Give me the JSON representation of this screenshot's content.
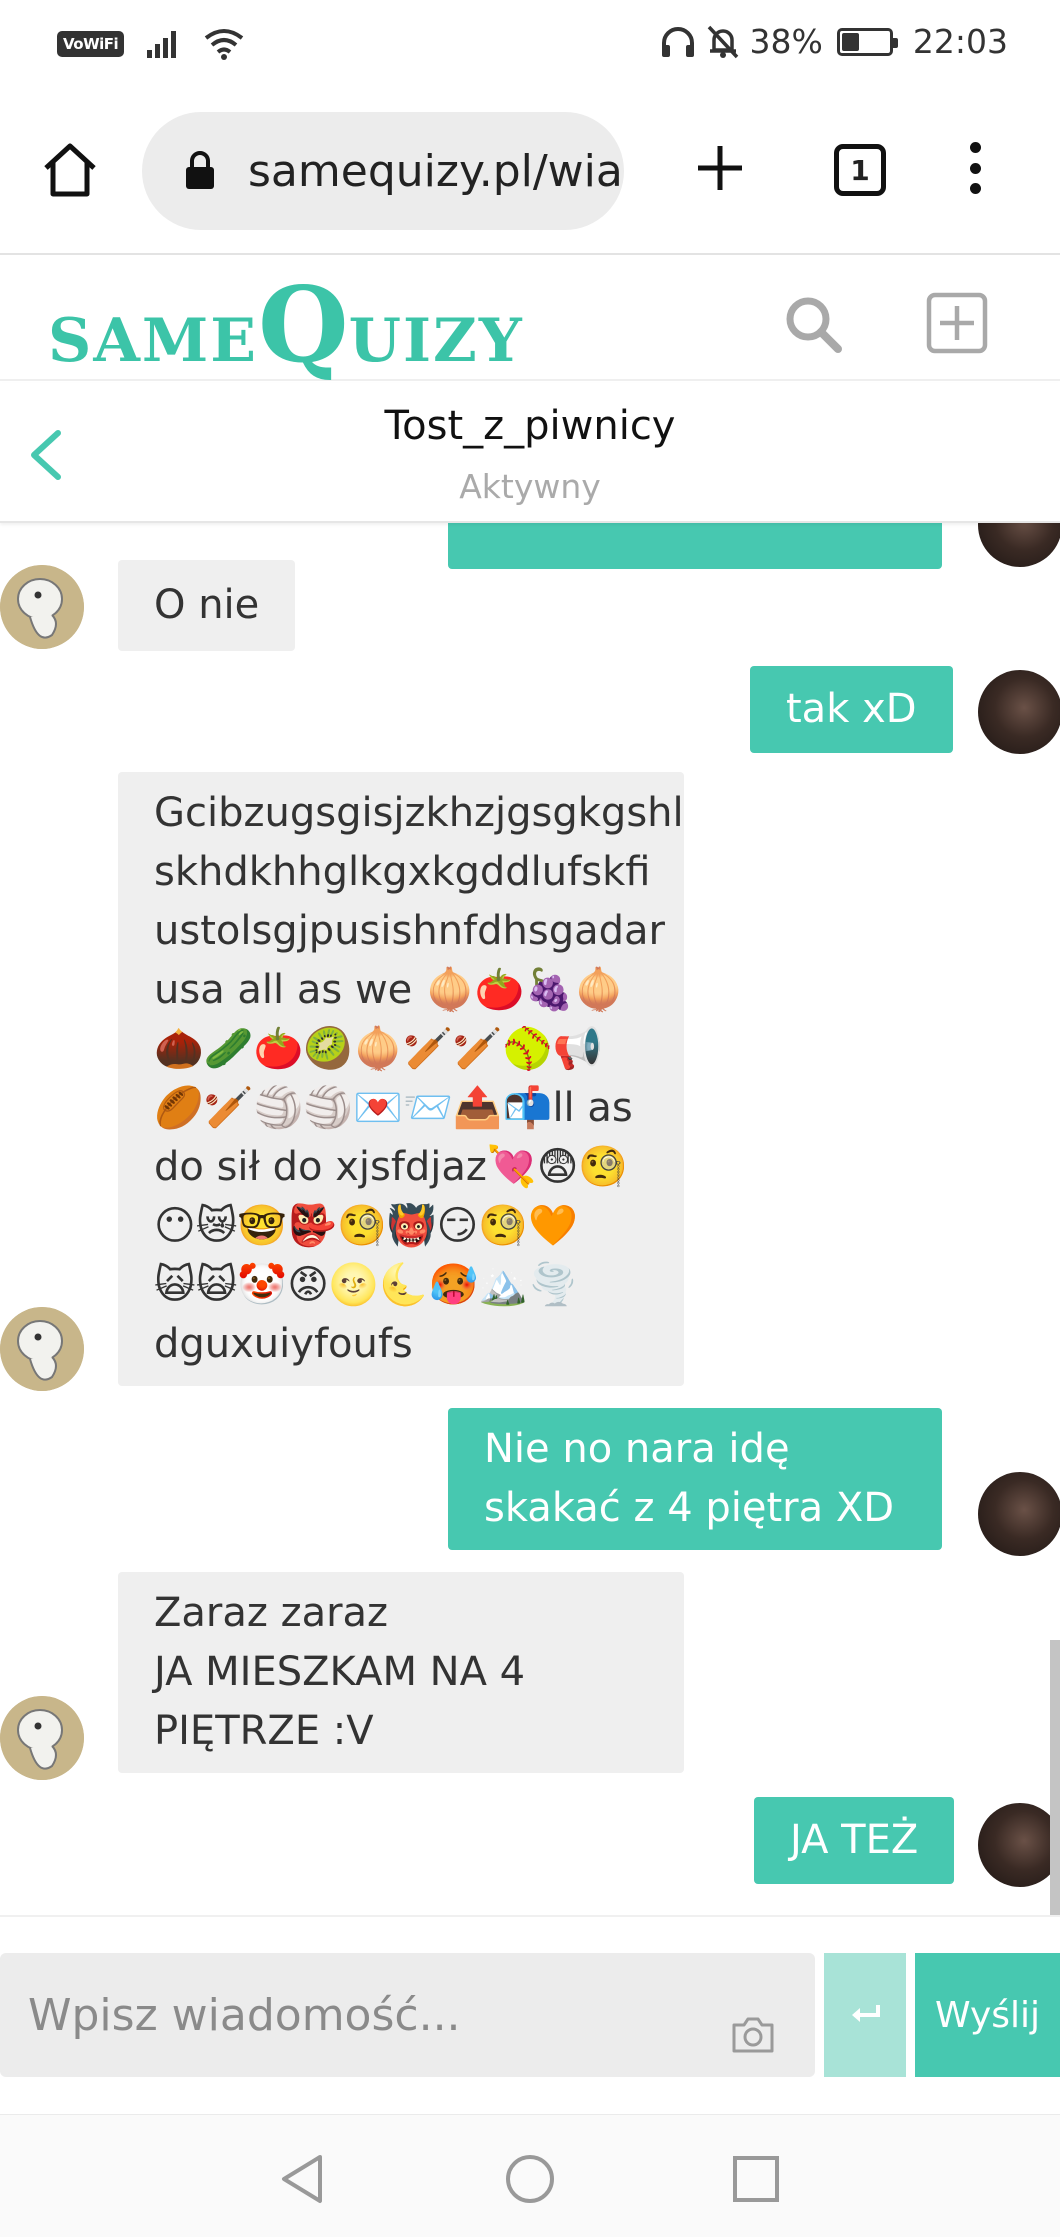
{
  "status_bar": {
    "network_badge": "VoWiFi",
    "battery": "38%",
    "battery_level": 0.38,
    "time": "22:03",
    "icons": [
      "signal-icon",
      "wifi-icon",
      "headphones-icon",
      "mute-bell-icon",
      "battery-icon"
    ]
  },
  "browser": {
    "url": "samequizy.pl/wia",
    "tab_count": "1"
  },
  "site": {
    "logo_part1": "SAME",
    "logo_part2": "Q",
    "logo_part3": "UIZY",
    "accent_color": "#47c8b0"
  },
  "chat": {
    "title": "Tost_z_piwnicy",
    "status": "Aktywny"
  },
  "messages": [
    {
      "side": "in",
      "text": "O nie"
    },
    {
      "side": "out",
      "text": "tak xD"
    },
    {
      "side": "in",
      "lines": [
        "Gcibzugsgisjzkhzjgsgkgshl",
        "skhdkhhglkgxkgddlufskfi",
        "ustolsgjpusishnfdhsgadar",
        "usa all as we 🧅🍅🍇🧅",
        "🌰🥒🍅🥝🧅🏏🏏🥎📢",
        "🏉🏏🏐🏐💌📨📤📬ll as",
        "do sił do xjsfdjaz💘😨🧐",
        "😶😿🤓👺🧐👹😏🧐🧡",
        "🙀🙀🤡😡🌝🌜🥵🏔️🌪️",
        "dguxuiyfoufs"
      ]
    },
    {
      "side": "out",
      "lines": [
        "Nie no nara idę",
        "skakać z 4 piętra XD"
      ]
    },
    {
      "side": "in",
      "lines": [
        "Zaraz zaraz",
        "JA MIESZKAM NA 4",
        "PIĘTRZE :V"
      ]
    },
    {
      "side": "out",
      "text": "JA TEŻ"
    }
  ],
  "composer": {
    "placeholder": "Wpisz wiadomość...",
    "send_label": "Wyślij"
  }
}
